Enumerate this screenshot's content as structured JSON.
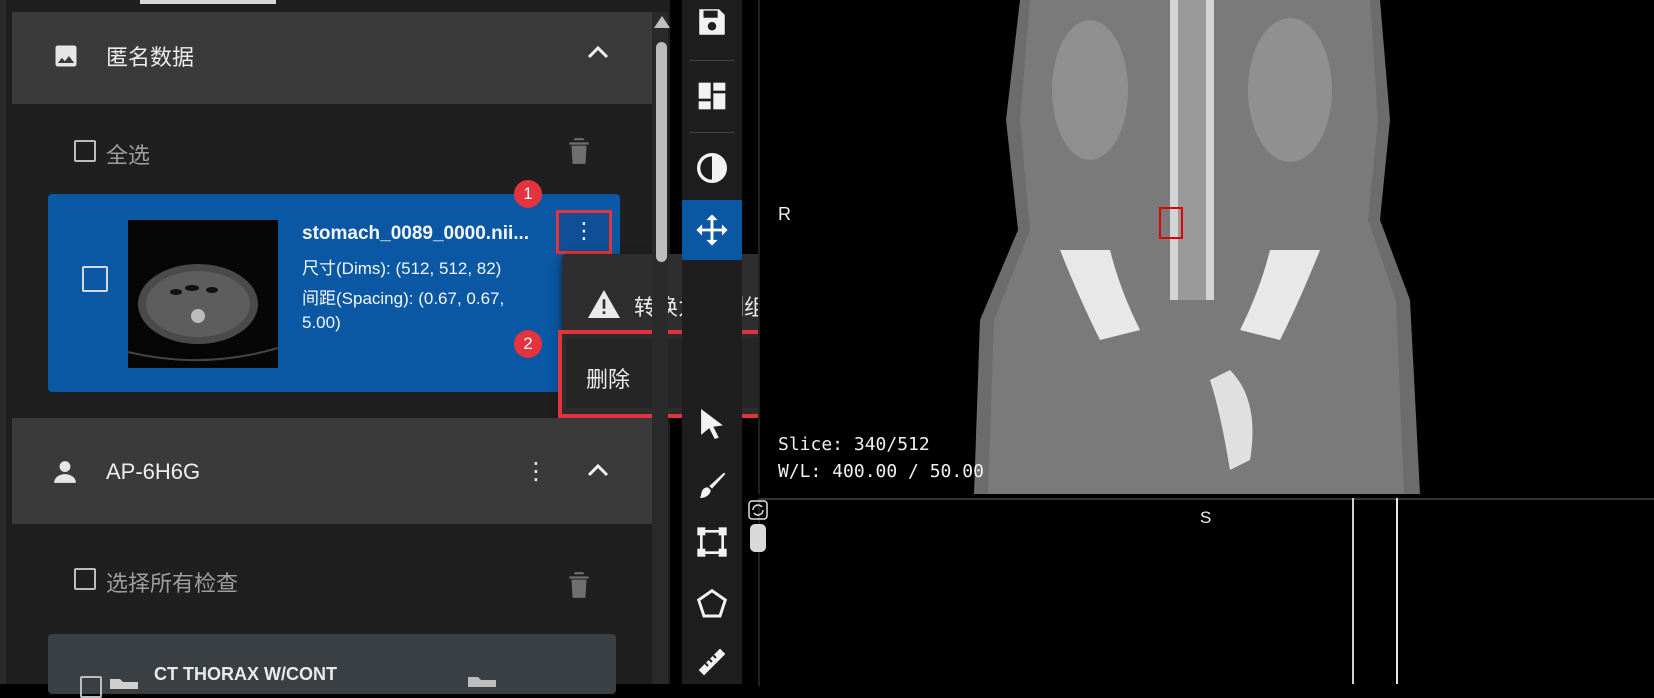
{
  "left_panel": {
    "anon_section": {
      "title": "匿名数据",
      "icon": "image-icon"
    },
    "select_all_label": "全选",
    "dataset": {
      "file_name": "stomach_0089_0000.nii...",
      "dims": "尺寸(Dims): (512, 512, 82)",
      "spacing_line1": "间距(Spacing): (0.67, 0.67,",
      "spacing_line2": "5.00)"
    },
    "patient_section": {
      "title": "AP-6H6G",
      "icon": "person-icon"
    },
    "select_all_studies_label": "选择所有检查",
    "study": {
      "title": "CT THORAX W/CONT"
    }
  },
  "context_menu": {
    "convert_label": "转换为分割组",
    "delete_label": "删除"
  },
  "badges": {
    "first": "1",
    "second": "2"
  },
  "viewport_top": {
    "orientation_left": "R",
    "slice": "Slice: 340/512",
    "wl": "W/L: 400.00 / 50.00"
  },
  "viewport_bottom": {
    "orientation_top": "S"
  },
  "colors": {
    "accent_blue": "#0a58a3",
    "highlight_red": "#e3333d"
  }
}
